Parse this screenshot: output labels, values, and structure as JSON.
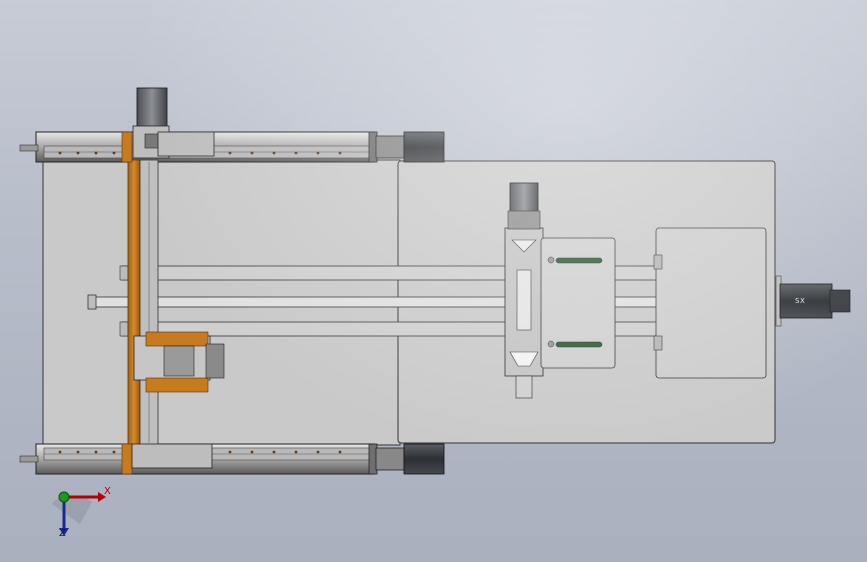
{
  "viewport": {
    "background_top": "#c7ccd6",
    "background_bottom": "#a9b0be"
  },
  "model": {
    "accent_orange": "#c87a1e",
    "plate_gray": "#c9c9c9",
    "motor_dark": "#3c3f44",
    "hose_green": "#2f5a36",
    "motor_label": "SX"
  },
  "triad": {
    "x_label": "X",
    "z_label": "Z",
    "x_color": "#b40000",
    "y_color": "#1d9a1d",
    "z_color": "#1a2a8c"
  }
}
